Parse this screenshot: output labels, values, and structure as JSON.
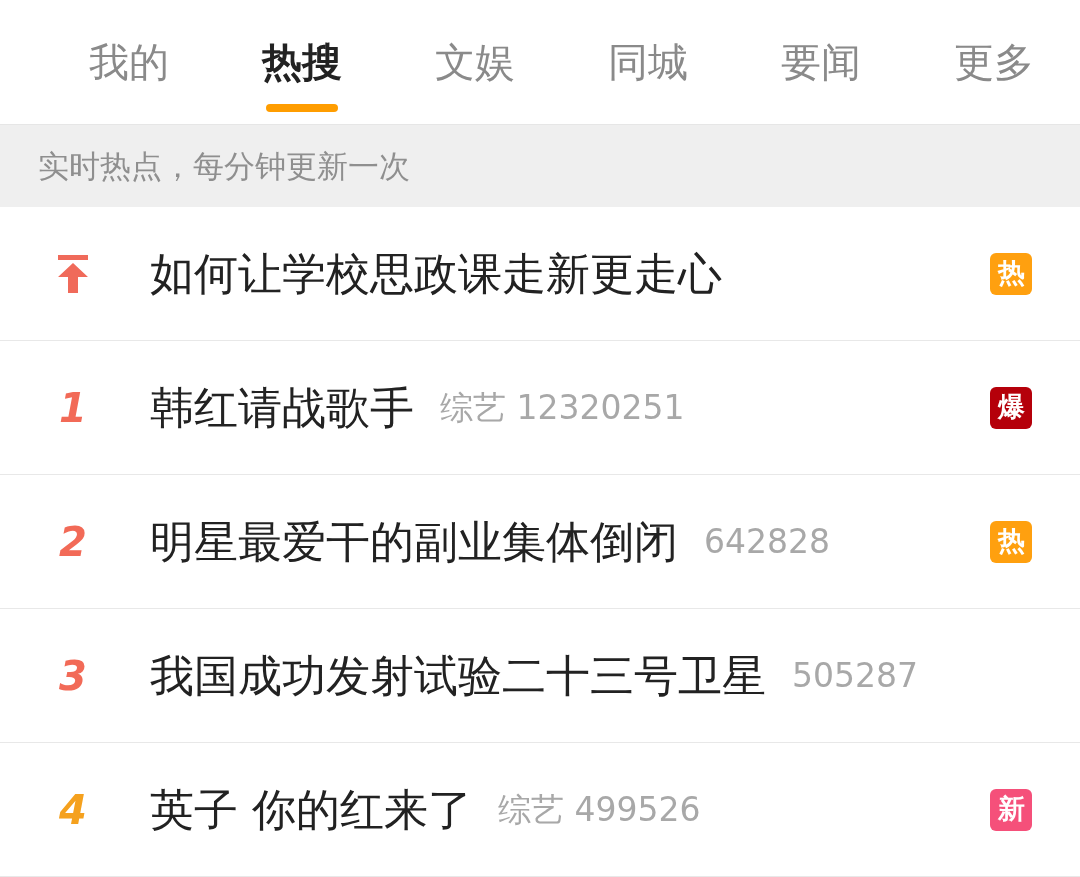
{
  "tabs": [
    {
      "label": "我的",
      "selected": false
    },
    {
      "label": "热搜",
      "selected": true
    },
    {
      "label": "文娱",
      "selected": false
    },
    {
      "label": "同城",
      "selected": false
    },
    {
      "label": "要闻",
      "selected": false
    },
    {
      "label": "更多",
      "selected": false
    }
  ],
  "notice": "实时热点，每分钟更新一次",
  "rows": [
    {
      "kind": "pinned",
      "title": "如何让学校思政课走新更走心",
      "badge": {
        "text": "热",
        "color": "#ffa00f"
      }
    },
    {
      "kind": "ranked",
      "rank": {
        "text": "1",
        "color": "#f26a57"
      },
      "title": "韩红请战歌手",
      "category": "综艺",
      "count": "12320251",
      "badge": {
        "text": "爆",
        "color": "#b5000a"
      }
    },
    {
      "kind": "ranked",
      "rank": {
        "text": "2",
        "color": "#f26a57"
      },
      "title": "明星最爱干的副业集体倒闭",
      "count": "642828",
      "badge": {
        "text": "热",
        "color": "#ffa00f"
      }
    },
    {
      "kind": "ranked",
      "rank": {
        "text": "3",
        "color": "#f26a57"
      },
      "title": "我国成功发射试验二十三号卫星",
      "count": "505287"
    },
    {
      "kind": "ranked",
      "rank": {
        "text": "4",
        "color": "#f5a11e"
      },
      "title": "英子 你的红来了",
      "category": "综艺",
      "count": "499526",
      "badge": {
        "text": "新",
        "color": "#f5507a"
      }
    }
  ]
}
